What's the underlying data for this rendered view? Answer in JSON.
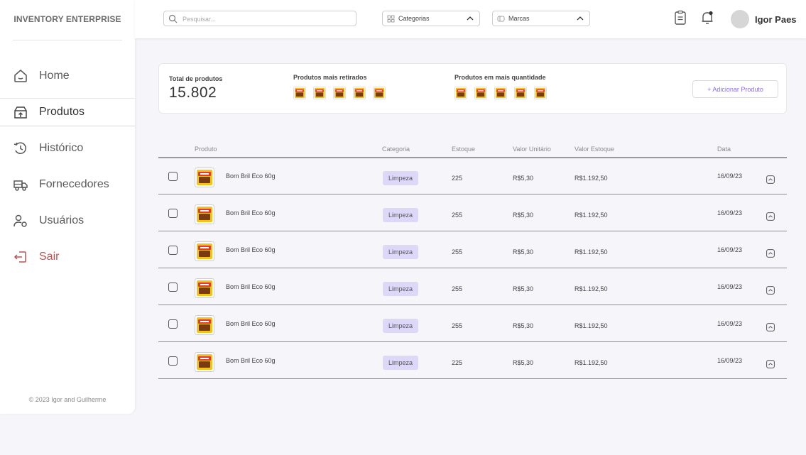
{
  "sidebar": {
    "brand": "INVENTORY ENTERPRISE",
    "items": [
      {
        "label": "Home",
        "icon": "home-icon"
      },
      {
        "label": "Produtos",
        "icon": "box-arrow-icon"
      },
      {
        "label": "Histórico",
        "icon": "history-icon"
      },
      {
        "label": "Fornecedores",
        "icon": "truck-icon"
      },
      {
        "label": "Usuários",
        "icon": "users-icon"
      },
      {
        "label": "Sair",
        "icon": "logout-icon"
      }
    ],
    "active": "Produtos",
    "footer": "© 2023 Igor and Guilherme"
  },
  "header": {
    "search_placeholder": "Pesquisar...",
    "categories_label": "Categorias",
    "brands_label": "Marcas",
    "user_name": "Igor Paes",
    "icons": [
      "clipboard-icon",
      "bell-icon"
    ]
  },
  "summary": {
    "total_label": "Total de produtos",
    "total_value": "15.802",
    "most_withdrawn_label": "Produtos mais retirados",
    "most_quantity_label": "Produtos em mais quantidade",
    "add_button": "+ Adicionar Produto"
  },
  "table": {
    "headers": {
      "produto": "Produto",
      "categoria": "Categoria",
      "estoque": "Estoque",
      "valor_unitario": "Valor Unitário",
      "valor_estoque": "Valor Estoque",
      "data": "Data"
    },
    "rows": [
      {
        "name": "Bom Bril Eco 60g",
        "category": "Limpeza",
        "stock": "225",
        "unit": "R$5,30",
        "total": "R$1.192,50",
        "date": "16/09/23"
      },
      {
        "name": "Bom Bril Eco 60g",
        "category": "Limpeza",
        "stock": "255",
        "unit": "R$5,30",
        "total": "R$1.192,50",
        "date": "16/09/23"
      },
      {
        "name": "Bom Bril Eco 60g",
        "category": "Limpeza",
        "stock": "255",
        "unit": "R$5,30",
        "total": "R$1.192,50",
        "date": "16/09/23"
      },
      {
        "name": "Bom Bril Eco 60g",
        "category": "Limpeza",
        "stock": "255",
        "unit": "R$5,30",
        "total": "R$1.192,50",
        "date": "16/09/23"
      },
      {
        "name": "Bom Bril Eco 60g",
        "category": "Limpeza",
        "stock": "255",
        "unit": "R$5,30",
        "total": "R$1.192,50",
        "date": "16/09/23"
      },
      {
        "name": "Bom Bril Eco 60g",
        "category": "Limpeza",
        "stock": "225",
        "unit": "R$5,30",
        "total": "R$1.192,50",
        "date": "16/09/23"
      }
    ]
  },
  "colors": {
    "accent": "#8a6ff0",
    "badge_bg": "#ddd8f7",
    "logout": "#c0504d",
    "background": "#f5f5fa"
  }
}
